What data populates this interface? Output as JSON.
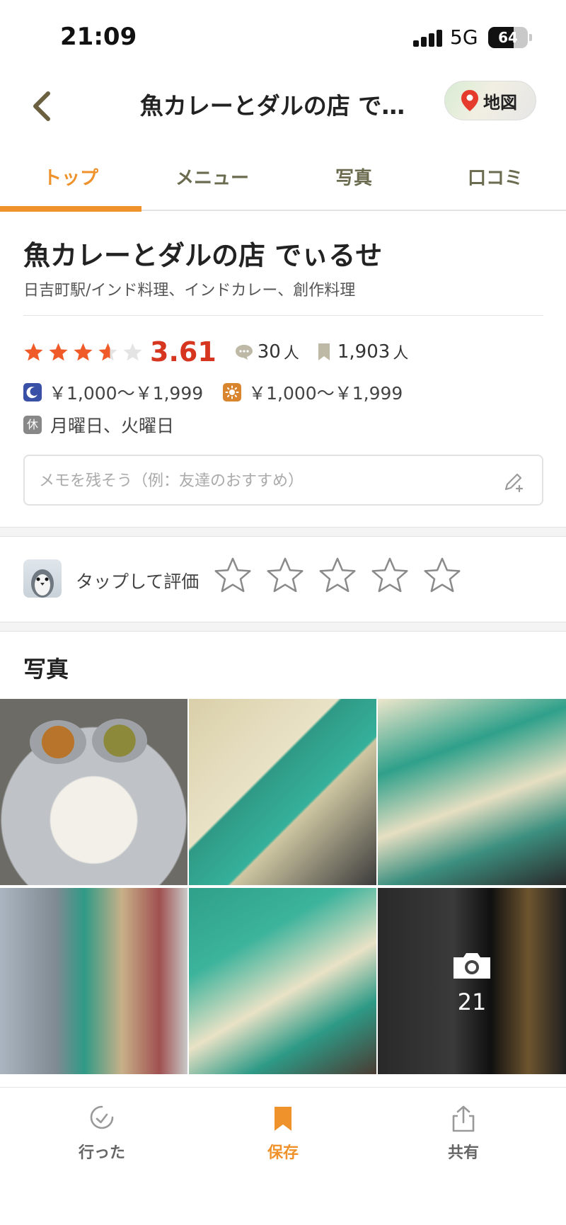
{
  "status_bar": {
    "time": "21:09",
    "network": "5G",
    "battery": "64",
    "battery_level": 0.64
  },
  "header": {
    "title": "魚カレーとダルの店 で…",
    "map_label": "地図"
  },
  "tabs": [
    {
      "label": "トップ",
      "active": true
    },
    {
      "label": "メニュー",
      "active": false
    },
    {
      "label": "写真",
      "active": false
    },
    {
      "label": "口コミ",
      "active": false
    }
  ],
  "shop": {
    "name": "魚カレーとダルの店 でぃるせ",
    "subtitle": "日吉町駅/インド料理、インドカレー、創作料理",
    "rating": "3.61",
    "rating_value": 3.61,
    "reviews_count": "30",
    "reviews_unit": "人",
    "saves_count": "1,903",
    "saves_unit": "人",
    "dinner_price": "￥1,000～￥1,999",
    "lunch_price": "￥1,000～￥1,999",
    "closed_badge": "休",
    "closed_days": "月曜日、火曜日"
  },
  "memo": {
    "placeholder": "メモを残そう（例：友達のおすすめ）"
  },
  "rate": {
    "label": "タップして評価"
  },
  "photos": {
    "heading": "写真",
    "more_count": "21"
  },
  "bottom_nav": [
    {
      "label": "行った",
      "icon": "check-circle-icon",
      "active": false
    },
    {
      "label": "保存",
      "icon": "bookmark-icon",
      "active": true
    },
    {
      "label": "共有",
      "icon": "share-icon",
      "active": false
    }
  ],
  "colors": {
    "accent": "#f0922b",
    "star": "#f05a28",
    "score": "#d63520",
    "dinner_badge": "#3a4fa6",
    "lunch_badge": "#d9852e"
  }
}
